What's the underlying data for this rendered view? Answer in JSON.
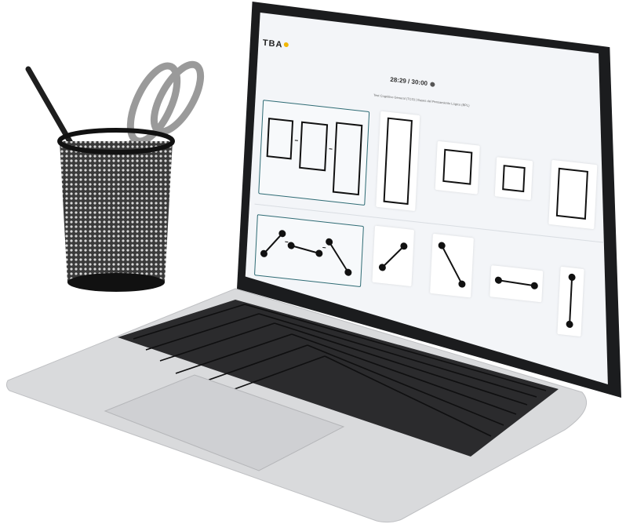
{
  "app": {
    "logo_text": "TBA",
    "timer_text": "28:29 / 30:00",
    "subtitle": "Test Cognitivo General (TCG) | Bases del Pensamiento Lógico (BPL)"
  },
  "questions": [
    {
      "id": "q1",
      "type": "rectangle-sequence",
      "options_count": 4
    },
    {
      "id": "q2",
      "type": "dumbbell-rotation",
      "options_count": 4
    }
  ],
  "colors": {
    "selection_border": "#2e6b74",
    "screen_bg": "#f3f5f8",
    "logo_accent": "#f2b705"
  },
  "icons": [
    "timer-icon",
    "logo-dot-icon"
  ]
}
